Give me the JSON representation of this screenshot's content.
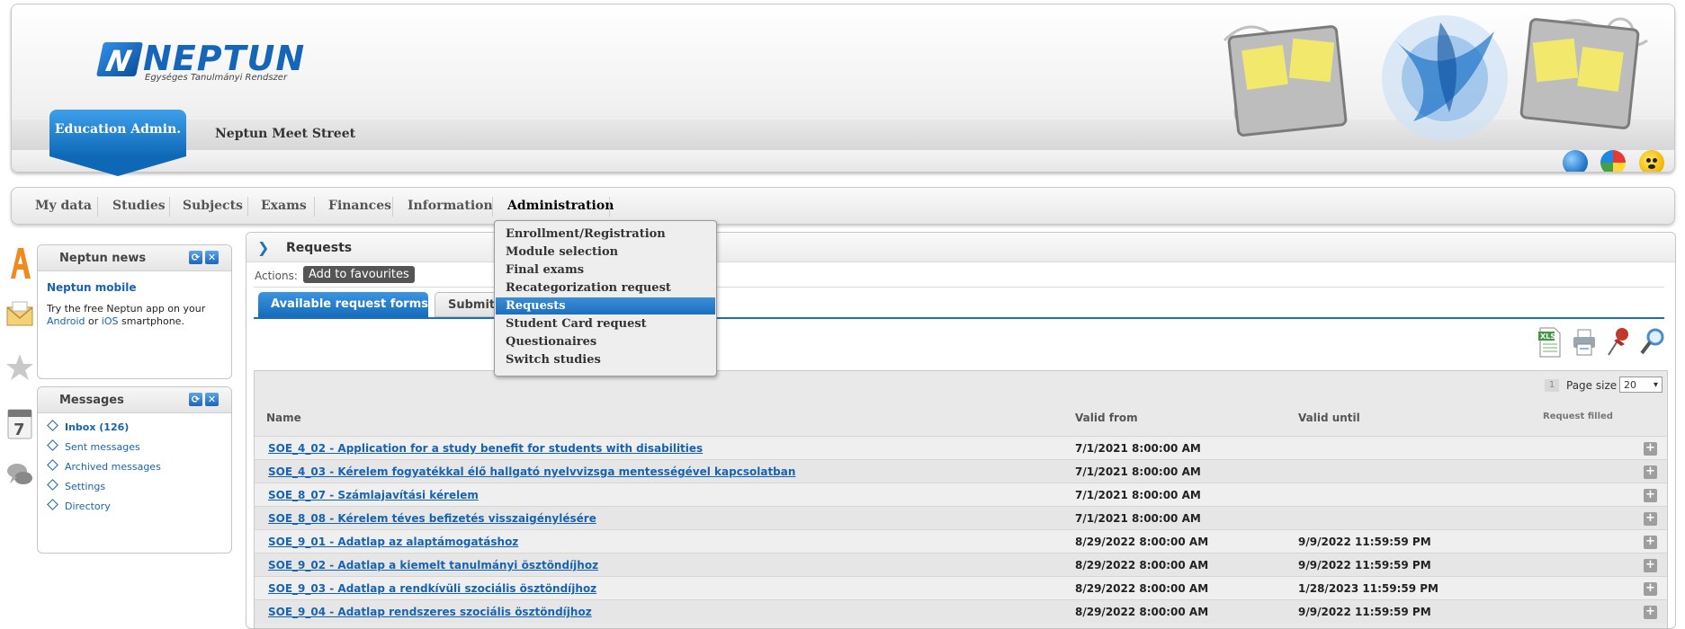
{
  "header": {
    "logo_title": "NEPTUN",
    "logo_subtitle": "Egységes Tanulmányi Rendszer",
    "logo_mark": "N",
    "role": "Education Admin.",
    "site_name": "Neptun Meet Street",
    "icons": [
      "globe-icon",
      "color-wheel-icon",
      "accessibility-icon"
    ]
  },
  "nav": {
    "items": [
      "My data",
      "Studies",
      "Subjects",
      "Exams",
      "Finances",
      "Information",
      "Administration"
    ],
    "active": "Administration"
  },
  "dropdown": {
    "items": [
      "Enrollment/Registration",
      "Module selection",
      "Final exams",
      "Recategorization request",
      "Requests",
      "Student Card request",
      "Questionaires",
      "Switch studies"
    ],
    "selected": "Requests"
  },
  "rail_icons": [
    "a-letter-icon",
    "envelope-icon",
    "star-icon",
    "calendar-icon",
    "chat-bubbles-icon"
  ],
  "news": {
    "title": "Neptun news",
    "link": "Neptun mobile",
    "text_before": "Try the free Neptun app on your",
    "android": "Android",
    "or": "or",
    "ios": "iOS",
    "text_after": "smartphone."
  },
  "messages": {
    "title": "Messages",
    "items": [
      "Inbox (126)",
      "Sent messages",
      "Archived messages",
      "Settings",
      "Directory"
    ]
  },
  "content": {
    "title": "Requests",
    "actions_label": "Actions:",
    "favourites_button": "Add to favourites",
    "tabs": [
      "Available request forms",
      "Submitted"
    ],
    "toolbar_icons": [
      "xls-export-icon",
      "print-icon",
      "pin-icon",
      "search-magnifier-icon"
    ]
  },
  "grid": {
    "page_number": "1",
    "page_size_label": "Page size",
    "page_size_value": "20",
    "columns": [
      "Name",
      "Valid from",
      "Valid until",
      "Request filled"
    ],
    "rows": [
      {
        "name": "SOE_4_02 - Application for a study benefit for students with disabilities",
        "from": "7/1/2021 8:00:00 AM",
        "until": ""
      },
      {
        "name": "SOE_4_03 - Kérelem fogyatékkal élő hallgató nyelvvizsga mentességével kapcsolatban",
        "from": "7/1/2021 8:00:00 AM",
        "until": ""
      },
      {
        "name": "SOE_8_07 - Számlajavítási kérelem",
        "from": "7/1/2021 8:00:00 AM",
        "until": ""
      },
      {
        "name": "SOE_8_08 - Kérelem téves befizetés visszaigénylésére",
        "from": "7/1/2021 8:00:00 AM",
        "until": ""
      },
      {
        "name": "SOE_9_01 - Adatlap az alaptámogatáshoz",
        "from": "8/29/2022 8:00:00 AM",
        "until": "9/9/2022 11:59:59 PM"
      },
      {
        "name": "SOE_9_02 - Adatlap a kiemelt tanulmányi ösztöndíjhoz",
        "from": "8/29/2022 8:00:00 AM",
        "until": "9/9/2022 11:59:59 PM"
      },
      {
        "name": "SOE_9_03 - Adatlap a rendkívüli szociális ösztöndíjhoz",
        "from": "8/29/2022 8:00:00 AM",
        "until": "1/28/2023 11:59:59 PM"
      },
      {
        "name": "SOE_9_04 - Adatlap rendszeres szociális ösztöndíjhoz",
        "from": "8/29/2022 8:00:00 AM",
        "until": "9/9/2022 11:59:59 PM"
      }
    ]
  },
  "colors": {
    "brand_blue": "#1565b8",
    "link_blue": "#1763b3",
    "tab_active": "#156bb9"
  }
}
